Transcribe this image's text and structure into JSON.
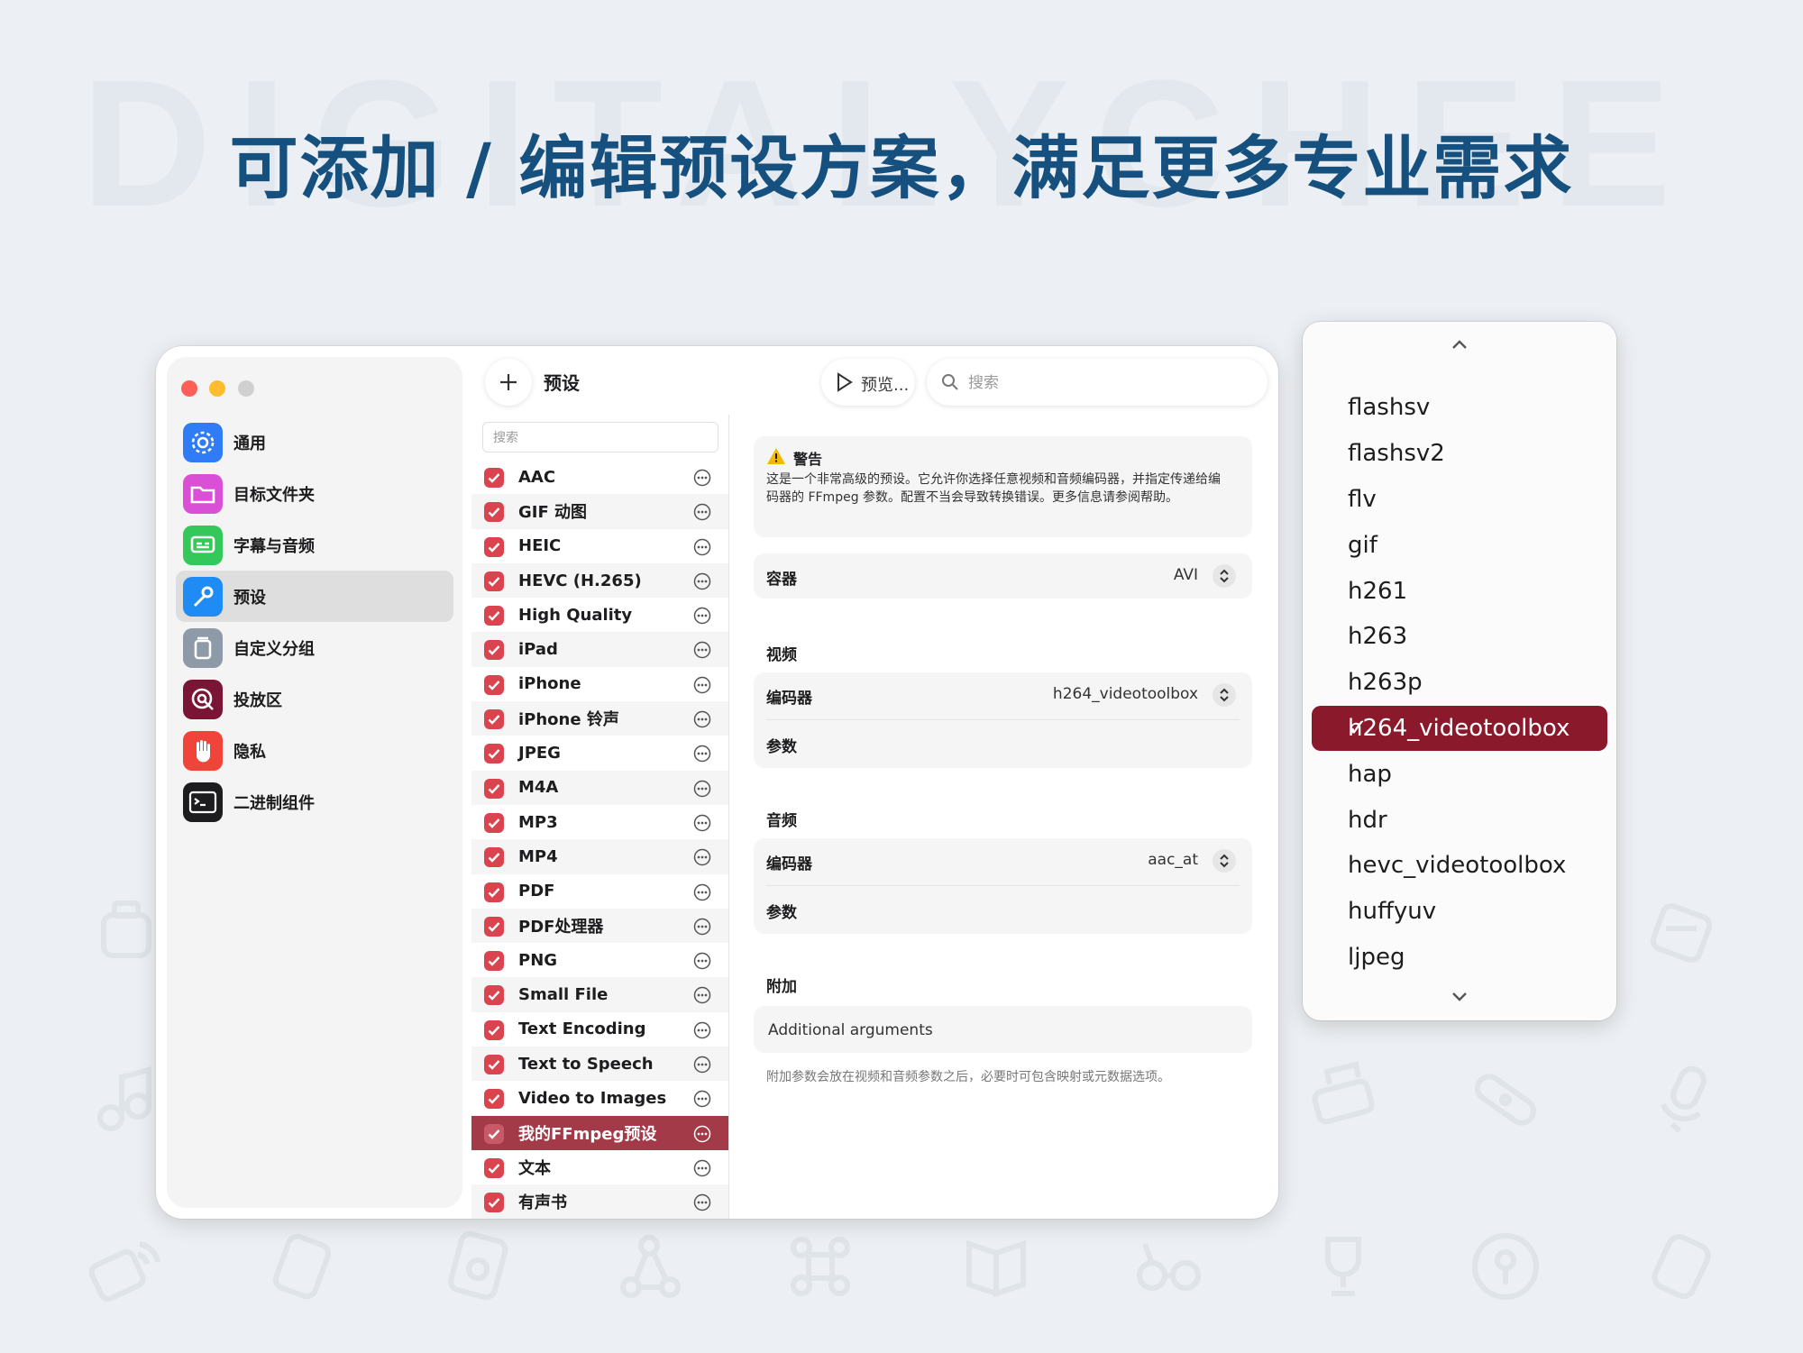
{
  "watermark": "DIGITALYCHEE",
  "headline": "可添加 / 编辑预设方案，满足更多专业需求",
  "sidebar": {
    "items": [
      {
        "label": "通用",
        "icon": "gear-icon",
        "color": "#2f7cf6"
      },
      {
        "label": "目标文件夹",
        "icon": "folder-icon",
        "color": "#d94fd6"
      },
      {
        "label": "字幕与音频",
        "icon": "subtitle-icon",
        "color": "#34c759"
      },
      {
        "label": "预设",
        "icon": "wrench-icon",
        "color": "#1f8cf5"
      },
      {
        "label": "自定义分组",
        "icon": "box-icon",
        "color": "#8e9aa8"
      },
      {
        "label": "投放区",
        "icon": "drop-target-icon",
        "color": "#7a1536"
      },
      {
        "label": "隐私",
        "icon": "hand-icon",
        "color": "#f0433a"
      },
      {
        "label": "二进制组件",
        "icon": "terminal-icon",
        "color": "#1d1d1f"
      }
    ],
    "selected_index": 3
  },
  "toolbar": {
    "title": "预设",
    "preview_label": "预览...",
    "search_placeholder": "搜索"
  },
  "preset_list": {
    "search_placeholder": "搜索",
    "items": [
      "AAC",
      "GIF 动图",
      "HEIC",
      "HEVC (H.265)",
      "High Quality",
      "iPad",
      "iPhone",
      "iPhone 铃声",
      "JPEG",
      "M4A",
      "MP3",
      "MP4",
      "PDF",
      "PDF处理器",
      "PNG",
      "Small File",
      "Text Encoding",
      "Text to Speech",
      "Video to Images",
      "我的FFmpeg预设",
      "文本",
      "有声书"
    ],
    "selected_index": 19
  },
  "detail": {
    "warning_title": "警告",
    "warning_body": "这是一个非常高级的预设。它允许你选择任意视频和音频编码器，并指定传递给编码器的 FFmpeg 参数。配置不当会导致转换错误。更多信息请参阅帮助。",
    "container_label": "容器",
    "container_value": "AVI",
    "video_section": "视频",
    "video_encoder_label": "编码器",
    "video_encoder_value": "h264_videotoolbox",
    "video_params_label": "参数",
    "audio_section": "音频",
    "audio_encoder_label": "编码器",
    "audio_encoder_value": "aac_at",
    "audio_params_label": "参数",
    "extra_section": "附加",
    "extra_placeholder": "Additional arguments",
    "footnote": "附加参数会放在视频和音频参数之后，必要时可包含映射或元数据选项。"
  },
  "dropdown": {
    "items": [
      "flashsv",
      "flashsv2",
      "flv",
      "gif",
      "h261",
      "h263",
      "h263p",
      "h264_videotoolbox",
      "hap",
      "hdr",
      "hevc_videotoolbox",
      "huffyuv",
      "ljpeg"
    ],
    "selected_index": 7,
    "selected_color": "#8a1a2b"
  },
  "colors": {
    "headline": "#15507e",
    "accent": "#a33a48",
    "checkbox": "#d9444f"
  }
}
